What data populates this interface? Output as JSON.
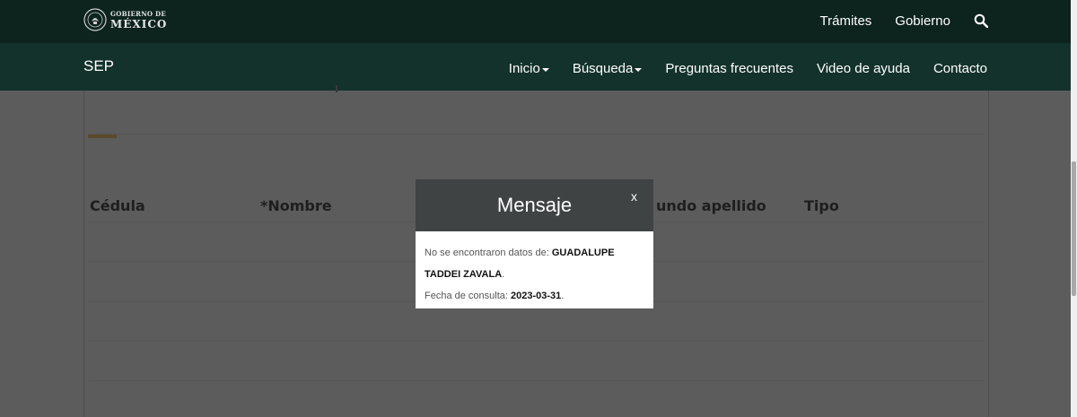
{
  "gov_bar": {
    "logo_line1": "GOBIERNO DE",
    "logo_line2": "MÉXICO",
    "nav": [
      "Trámites",
      "Gobierno"
    ],
    "search_icon": "search-icon"
  },
  "sep_bar": {
    "title": "SEP",
    "nav": [
      {
        "label": "Inicio",
        "has_dropdown": true
      },
      {
        "label": "Búsqueda",
        "has_dropdown": true
      },
      {
        "label": "Preguntas frecuentes",
        "has_dropdown": false
      },
      {
        "label": "Video de ayuda",
        "has_dropdown": false
      },
      {
        "label": "Contacto",
        "has_dropdown": false
      }
    ]
  },
  "table": {
    "headers": [
      "Cédula",
      "*Nombre",
      "undo apellido",
      "Tipo"
    ]
  },
  "modal": {
    "title": "Mensaje",
    "close": "x",
    "line1_prefix": "No se encontraron datos de:",
    "line1_name": "GUADALUPE",
    "line2_name": "TADDEI ZAVALA",
    "line2_suffix": ".",
    "line3_prefix": "Fecha de consulta:",
    "line3_date": "2023-03-31",
    "line3_suffix": "."
  },
  "colors": {
    "gov_bar": "#0c231e",
    "sep_bar": "#13322b",
    "overlay": "#5c5c5c",
    "modal_header": "#3f4343"
  }
}
